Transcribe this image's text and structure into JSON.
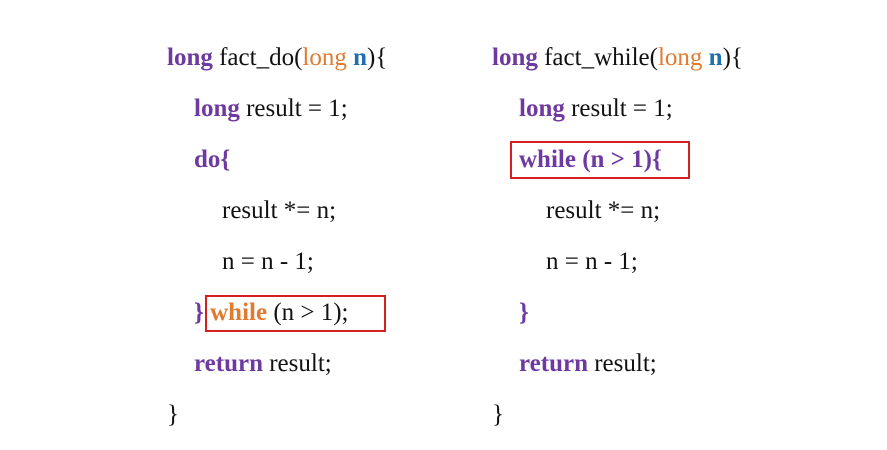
{
  "left": {
    "sig_kw": "long",
    "sig_name": " fact_do(",
    "sig_param_type": "long",
    "sig_param_name": " n",
    "sig_end": "){",
    "l2_kw": "long",
    "l2_rest": " result = 1;",
    "l3_kw": "do{",
    "l4": "result *= n;",
    "l5": "n = n - 1;",
    "l6_brace": "}",
    "l6_kw": "while",
    "l6_rest": " (n > 1);",
    "l7_kw": "return",
    "l7_rest": " result;",
    "l8": "}"
  },
  "right": {
    "sig_kw": "long",
    "sig_name": " fact_while(",
    "sig_param_type": "long",
    "sig_param_name": " n",
    "sig_end": "){",
    "l2_kw": "long",
    "l2_rest": " result = 1;",
    "l3": "while (n > 1){",
    "l4": "result *= n;",
    "l5": "n = n - 1;",
    "l6": "}",
    "l7_kw": "return",
    "l7_rest": " result;",
    "l8": "}"
  },
  "colors": {
    "keyword": "#6e3aa0",
    "type_param": "#e07b2f",
    "param_name": "#1f6fae",
    "highlight_box": "#d61f1f"
  }
}
